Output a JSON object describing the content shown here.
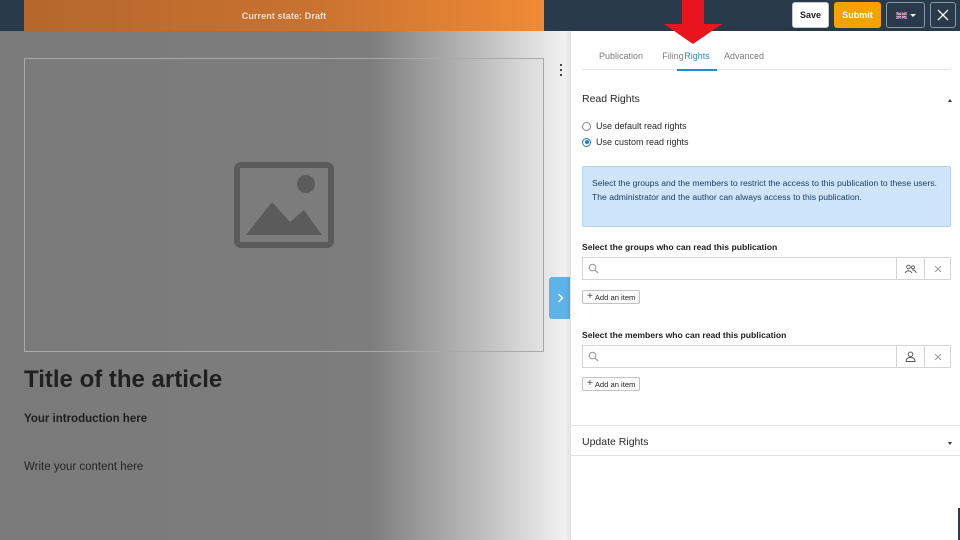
{
  "topbar": {
    "state_label": "Current state: Draft",
    "save_label": "Save",
    "submit_label": "Submit",
    "language_flag": "uk-flag-icon",
    "close_icon": "close-icon"
  },
  "editor": {
    "image_placeholder_icon": "image-icon",
    "title": "Title of the article",
    "introduction": "Your introduction here",
    "content": "Write your content here"
  },
  "panel": {
    "tabs": [
      {
        "label": "Publication",
        "active": false
      },
      {
        "label": "Filing",
        "active": false
      },
      {
        "label": "Rights",
        "active": true
      },
      {
        "label": "Advanced",
        "active": false
      }
    ],
    "read_rights": {
      "title": "Read Rights",
      "options": [
        {
          "label": "Use default read rights",
          "checked": false
        },
        {
          "label": "Use custom read rights",
          "checked": true
        }
      ],
      "info": "Select the groups and the members to restrict the access to this publication to these users. The administrator and the author can always access to this publication.",
      "groups_label": "Select the groups who can read this publication",
      "groups_placeholder": "",
      "members_label": "Select the members who can read this publication",
      "members_placeholder": "",
      "add_item_label": "Add an item"
    },
    "update_rights": {
      "title": "Update Rights"
    }
  },
  "colors": {
    "topbar_bg": "#293a4a",
    "submit": "#f5a200",
    "accent": "#1a8fd6",
    "info_bg": "#cfe5fb",
    "annotation_arrow": "#e8141e"
  }
}
